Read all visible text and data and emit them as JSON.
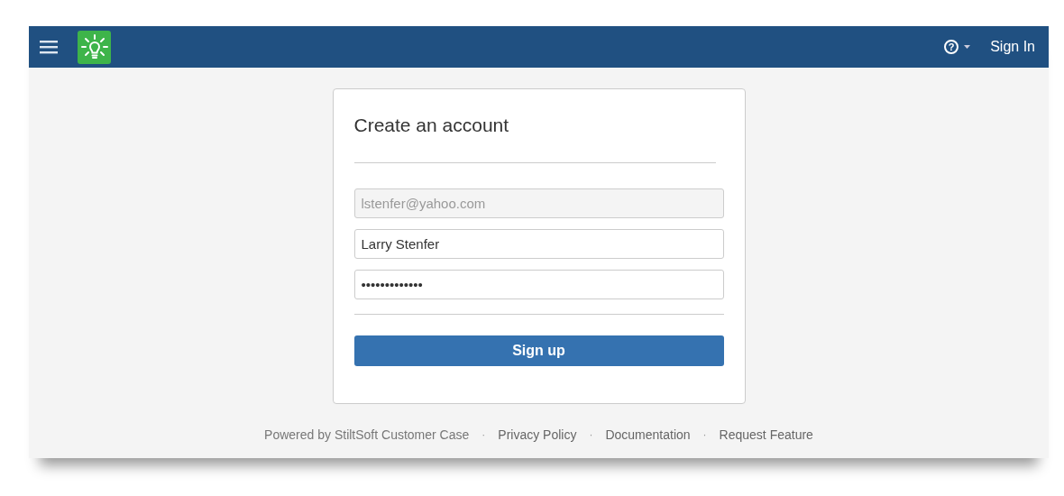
{
  "navbar": {
    "help_label": "?",
    "sign_in": "Sign In"
  },
  "form": {
    "title": "Create an account",
    "fields": [
      {
        "value": "lstenfer@yahoo.com",
        "disabled": true
      },
      {
        "value": "Larry Stenfer",
        "disabled": false
      },
      {
        "value": "•••••••••••••",
        "disabled": false
      }
    ],
    "submit": "Sign up"
  },
  "footer": [
    {
      "kind": "text",
      "label": "Powered by StiltSoft Customer Case"
    },
    {
      "kind": "separator",
      "label": "·"
    },
    {
      "kind": "link",
      "label": "Privacy Policy"
    },
    {
      "kind": "separator",
      "label": "·"
    },
    {
      "kind": "link",
      "label": "Documentation"
    },
    {
      "kind": "separator",
      "label": "·"
    },
    {
      "kind": "link",
      "label": "Request Feature"
    }
  ]
}
